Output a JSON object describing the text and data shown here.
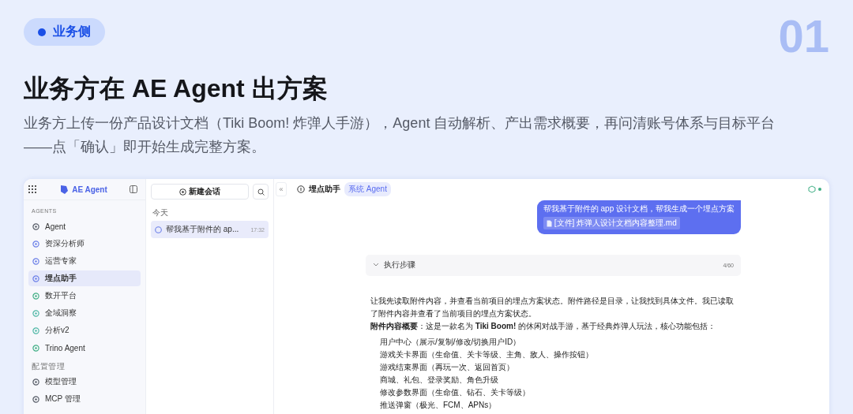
{
  "tag": {
    "label": "业务侧"
  },
  "page_number": "01",
  "title": "业务方在 AE Agent 出方案",
  "description": "业务方上传一份产品设计文档（Tiki Boom! 炸弹人手游），Agent 自动解析、产出需求概要，再问清账号体系与目标平台——点「确认」即开始生成完整方案。",
  "app": {
    "sidebar": {
      "logo": "AE Agent",
      "sections": [
        {
          "heading": "AGENTS",
          "items": [
            {
              "label": "Agent",
              "selected": false,
              "color": "#555b66"
            },
            {
              "label": "资深分析师",
              "selected": false,
              "color": "#6b7fe8"
            },
            {
              "label": "运营专家",
              "selected": false,
              "color": "#6b7fe8"
            },
            {
              "label": "埋点助手",
              "selected": true,
              "color": "#6b7fe8"
            },
            {
              "label": "数开平台",
              "selected": false,
              "color": "#3fae84"
            },
            {
              "label": "全域洞察",
              "selected": false,
              "color": "#4fb7a6"
            },
            {
              "label": "分析v2",
              "selected": false,
              "color": "#4fb7a6"
            },
            {
              "label": "Trino Agent",
              "selected": false,
              "color": "#3fae84"
            }
          ]
        },
        {
          "heading": "配置管理",
          "items": [
            {
              "label": "模型管理",
              "selected": false,
              "color": "#555b66"
            },
            {
              "label": "MCP 管理",
              "selected": false,
              "color": "#555b66"
            }
          ]
        }
      ]
    },
    "conversations": {
      "new_button": "新建会话",
      "groups": [
        {
          "heading": "今天",
          "items": [
            {
              "title": "帮我基于附件的 ap...",
              "time": "17:32",
              "selected": true
            }
          ]
        }
      ]
    },
    "chat": {
      "collapse_button": "«",
      "title": "埋点助手",
      "badge": "系统 Agent",
      "user_message": {
        "text": "帮我基于附件的 app 设计文档，帮我生成一个埋点方案",
        "attachment": "[文件] 炸弹人设计文档内容整理.md"
      },
      "steps": {
        "label": "执行步骤",
        "count": "4/60"
      },
      "reply": {
        "paragraphs": [
          "让我先读取附件内容，并查看当前项目的埋点方案状态。附件路径是目录，让我找到具体文件。我已读取了附件内容并查看了当前项目的埋点方案状态。",
          "**附件内容概要**：这是一款名为 **Tiki Boom!** 的休闲对战手游，基于经典炸弹人玩法，核心功能包括："
        ],
        "list": [
          "用户中心（展示/复制/修改/切换用户ID）",
          "游戏关卡界面（生命值、关卡等级、主角、敌人、操作按钮）",
          "游戏结束界面（再玩一次、返回首页）",
          "商城、礼包、登录奖励、角色升级",
          "修改参数界面（生命值、钻石、关卡等级）",
          "推送弹窗（极光、FCM、APNs）"
        ]
      }
    }
  }
}
